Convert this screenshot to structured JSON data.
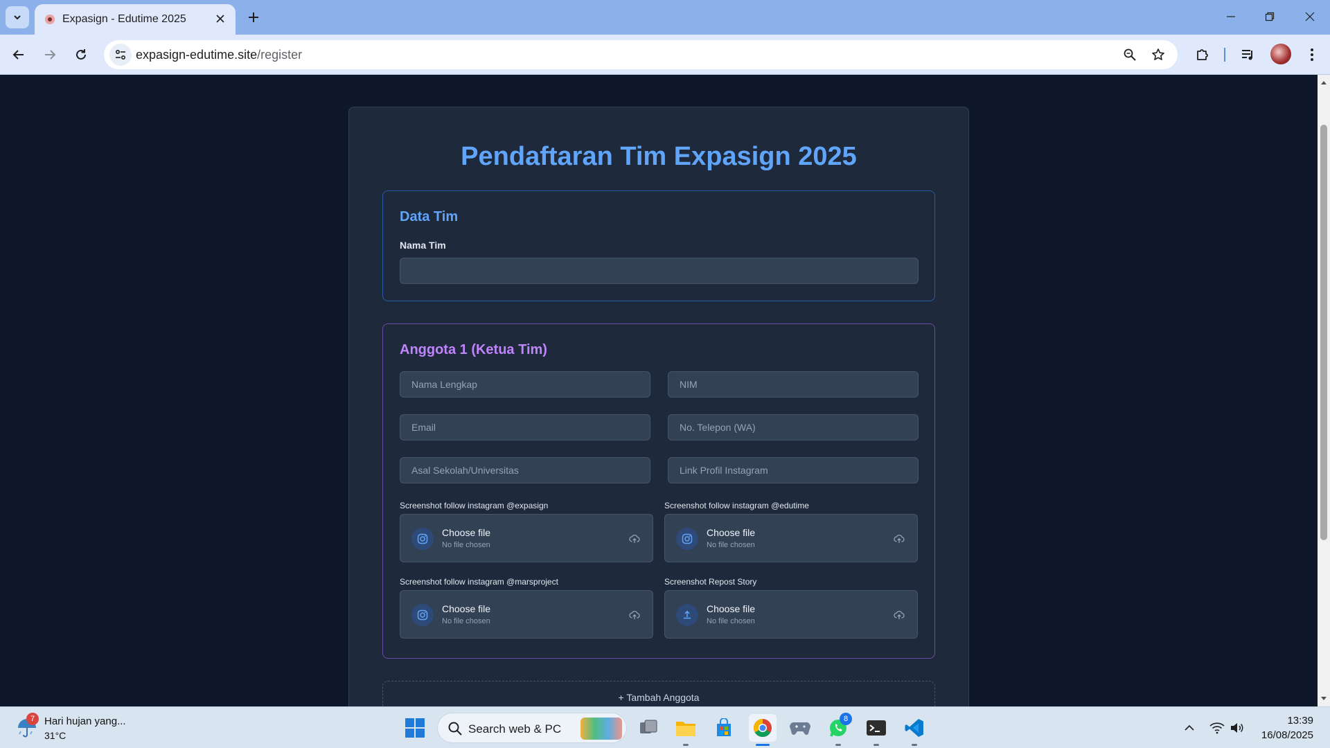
{
  "browser": {
    "tab_title": "Expasign - Edutime 2025",
    "url_domain": "expasign-edutime.site",
    "url_path": "/register"
  },
  "page": {
    "title": "Pendaftaran Tim Expasign 2025",
    "team_section": {
      "title": "Data Tim",
      "team_name_label": "Nama Tim",
      "team_name_value": ""
    },
    "member_section": {
      "title": "Anggota 1 (Ketua Tim)",
      "fields": {
        "full_name": "Nama Lengkap",
        "nim": "NIM",
        "email": "Email",
        "phone": "No. Telepon (WA)",
        "school": "Asal Sekolah/Universitas",
        "instagram": "Link Profil Instagram"
      },
      "uploads": [
        {
          "label": "Screenshot follow instagram @expasign",
          "button": "Choose file",
          "status": "No file chosen",
          "icon": "instagram-icon"
        },
        {
          "label": "Screenshot follow instagram @edutime",
          "button": "Choose file",
          "status": "No file chosen",
          "icon": "instagram-icon"
        },
        {
          "label": "Screenshot follow instagram @marsproject",
          "button": "Choose file",
          "status": "No file chosen",
          "icon": "instagram-icon"
        },
        {
          "label": "Screenshot Repost Story",
          "button": "Choose file",
          "status": "No file chosen",
          "icon": "upload-icon"
        }
      ]
    },
    "add_member_label": "+ Tambah Anggota"
  },
  "taskbar": {
    "weather_text": "Hari hujan yang...",
    "weather_temp": "31°C",
    "weather_badge": "7",
    "search_placeholder": "Search web & PC",
    "whatsapp_badge": "8",
    "time": "13:39",
    "date": "16/08/2025"
  },
  "colors": {
    "page_bg": "#0f172a",
    "card_bg": "#1e293b",
    "title_blue": "#60a5fa",
    "member_purple": "#c084fc",
    "input_bg": "#334155"
  }
}
